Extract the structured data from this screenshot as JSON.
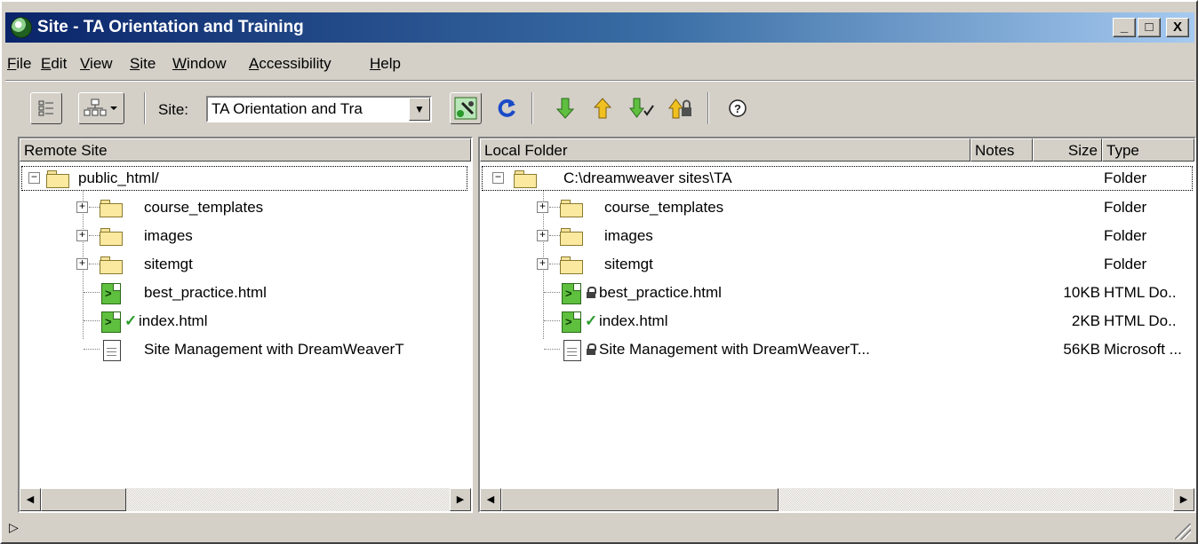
{
  "window": {
    "title": "Site - TA Orientation and Training",
    "controls": {
      "minimize": "_",
      "maximize": "□",
      "close": "X"
    }
  },
  "menu": [
    {
      "underline": "F",
      "rest": "ile"
    },
    {
      "underline": "E",
      "rest": "dit"
    },
    {
      "underline": "V",
      "rest": "iew"
    },
    {
      "underline": "S",
      "rest": "ite"
    },
    {
      "underline": "W",
      "rest": "indow"
    },
    {
      "underline": "A",
      "rest": "ccessibility"
    },
    {
      "underline": "H",
      "rest": "elp"
    }
  ],
  "toolbar": {
    "site_label": "Site:",
    "site_value": "TA Orientation and Tra",
    "icons": [
      "site-files-view-icon",
      "site-map-view-icon",
      "connect-icon",
      "refresh-icon",
      "get-files-icon",
      "put-files-icon",
      "check-out-icon",
      "check-in-icon",
      "help-icon"
    ]
  },
  "remote": {
    "header": "Remote Site",
    "root": "public_html/",
    "items": [
      {
        "name": "course_templates",
        "kind": "folder"
      },
      {
        "name": "images",
        "kind": "folder"
      },
      {
        "name": "sitemgt",
        "kind": "folder"
      },
      {
        "name": "best_practice.html",
        "kind": "html"
      },
      {
        "name": "index.html",
        "kind": "html",
        "checked": true
      },
      {
        "name": "Site Management with DreamWeaverT",
        "kind": "doc"
      }
    ]
  },
  "local": {
    "headers": {
      "folder": "Local Folder",
      "notes": "Notes",
      "size": "Size",
      "type": "Type"
    },
    "root": {
      "name": "C:\\dreamweaver sites\\TA",
      "type": "Folder"
    },
    "items": [
      {
        "name": "course_templates",
        "kind": "folder",
        "size": "",
        "type": "Folder"
      },
      {
        "name": "images",
        "kind": "folder",
        "size": "",
        "type": "Folder"
      },
      {
        "name": "sitemgt",
        "kind": "folder",
        "size": "",
        "type": "Folder"
      },
      {
        "name": "best_practice.html",
        "kind": "html",
        "locked": true,
        "size": "10KB",
        "type": "HTML Do.."
      },
      {
        "name": "index.html",
        "kind": "html",
        "checked": true,
        "size": "2KB",
        "type": "HTML Do.."
      },
      {
        "name": "Site Management with DreamWeaverT...",
        "kind": "doc",
        "locked": true,
        "size": "56KB",
        "type": "Microsoft ..."
      }
    ]
  },
  "status": {
    "expand_glyph": "▷"
  },
  "colors": {
    "title_start": "#0a246a",
    "title_end": "#a6caf0",
    "face": "#d4d0c8",
    "check": "#2a9a2a",
    "folder": "#fbe9a0"
  }
}
